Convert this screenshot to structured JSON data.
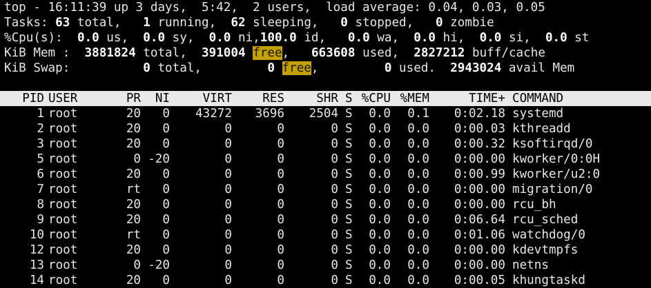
{
  "summary": {
    "top": {
      "prefix": "top - ",
      "time": "16:11:39",
      "uptime": " up 3 days,  5:42,  2 users,  load average: 0.04, 0.03, 0.05"
    },
    "tasks": {
      "label": "Tasks: ",
      "total": "63",
      "t1": " total,   ",
      "running": "1",
      "t2": " running,  ",
      "sleeping": "62",
      "t3": " sleeping,   ",
      "stopped": "0",
      "t4": " stopped,   ",
      "zombie": "0",
      "t5": " zombie"
    },
    "cpu": {
      "label": "%Cpu(s):  ",
      "us": "0.0",
      "l_us": " us,  ",
      "sy": "0.0",
      "l_sy": " sy,  ",
      "ni": "0.0",
      "l_ni": " ni,",
      "id": "100.0",
      "l_id": " id,   ",
      "wa": "0.0",
      "l_wa": " wa,  ",
      "hi": "0.0",
      "l_hi": " hi,  ",
      "si": "0.0",
      "l_si": " si,  ",
      "st": "0.0",
      "l_st": " st"
    },
    "mem": {
      "label": "KiB Mem :  ",
      "total": "3881824",
      "l_total": " total,  ",
      "free": "391004",
      "l_free_pad": " ",
      "l_free": "free",
      "l_free2": ",   ",
      "used": "663608",
      "l_used": " used,  ",
      "buff": "2827212",
      "l_buff": " buff/cache"
    },
    "swap": {
      "label": "KiB Swap:          ",
      "total": "0",
      "l_total": " total,         ",
      "free": "0",
      "l_free_pad": " ",
      "l_free": "free",
      "l_free2": ",         ",
      "used": "0",
      "l_used": " used.  ",
      "avail": "2943024",
      "l_avail": " avail Mem"
    }
  },
  "columns": {
    "pid": "PID",
    "user": "USER",
    "pr": "PR",
    "ni": "NI",
    "virt": "VIRT",
    "res": "RES",
    "shr": "SHR",
    "s": "S",
    "cpu": "%CPU",
    "mem": "%MEM",
    "time": "TIME+",
    "command": "COMMAND"
  },
  "processes": [
    {
      "pid": "1",
      "user": "root",
      "pr": "20",
      "ni": "0",
      "virt": "43272",
      "res": "3696",
      "shr": "2504",
      "s": "S",
      "cpu": "0.0",
      "mem": "0.1",
      "time": "0:02.18",
      "command": "systemd"
    },
    {
      "pid": "2",
      "user": "root",
      "pr": "20",
      "ni": "0",
      "virt": "0",
      "res": "0",
      "shr": "0",
      "s": "S",
      "cpu": "0.0",
      "mem": "0.0",
      "time": "0:00.03",
      "command": "kthreadd"
    },
    {
      "pid": "3",
      "user": "root",
      "pr": "20",
      "ni": "0",
      "virt": "0",
      "res": "0",
      "shr": "0",
      "s": "S",
      "cpu": "0.0",
      "mem": "0.0",
      "time": "0:00.32",
      "command": "ksoftirqd/0"
    },
    {
      "pid": "5",
      "user": "root",
      "pr": "0",
      "ni": "-20",
      "virt": "0",
      "res": "0",
      "shr": "0",
      "s": "S",
      "cpu": "0.0",
      "mem": "0.0",
      "time": "0:00.00",
      "command": "kworker/0:0H"
    },
    {
      "pid": "6",
      "user": "root",
      "pr": "20",
      "ni": "0",
      "virt": "0",
      "res": "0",
      "shr": "0",
      "s": "S",
      "cpu": "0.0",
      "mem": "0.0",
      "time": "0:00.99",
      "command": "kworker/u2:0"
    },
    {
      "pid": "7",
      "user": "root",
      "pr": "rt",
      "ni": "0",
      "virt": "0",
      "res": "0",
      "shr": "0",
      "s": "S",
      "cpu": "0.0",
      "mem": "0.0",
      "time": "0:00.00",
      "command": "migration/0"
    },
    {
      "pid": "8",
      "user": "root",
      "pr": "20",
      "ni": "0",
      "virt": "0",
      "res": "0",
      "shr": "0",
      "s": "S",
      "cpu": "0.0",
      "mem": "0.0",
      "time": "0:00.00",
      "command": "rcu_bh"
    },
    {
      "pid": "9",
      "user": "root",
      "pr": "20",
      "ni": "0",
      "virt": "0",
      "res": "0",
      "shr": "0",
      "s": "S",
      "cpu": "0.0",
      "mem": "0.0",
      "time": "0:06.64",
      "command": "rcu_sched"
    },
    {
      "pid": "10",
      "user": "root",
      "pr": "rt",
      "ni": "0",
      "virt": "0",
      "res": "0",
      "shr": "0",
      "s": "S",
      "cpu": "0.0",
      "mem": "0.0",
      "time": "0:01.06",
      "command": "watchdog/0"
    },
    {
      "pid": "12",
      "user": "root",
      "pr": "20",
      "ni": "0",
      "virt": "0",
      "res": "0",
      "shr": "0",
      "s": "S",
      "cpu": "0.0",
      "mem": "0.0",
      "time": "0:00.00",
      "command": "kdevtmpfs"
    },
    {
      "pid": "13",
      "user": "root",
      "pr": "0",
      "ni": "-20",
      "virt": "0",
      "res": "0",
      "shr": "0",
      "s": "S",
      "cpu": "0.0",
      "mem": "0.0",
      "time": "0:00.00",
      "command": "netns"
    },
    {
      "pid": "14",
      "user": "root",
      "pr": "20",
      "ni": "0",
      "virt": "0",
      "res": "0",
      "shr": "0",
      "s": "S",
      "cpu": "0.0",
      "mem": "0.0",
      "time": "0:00.05",
      "command": "khungtaskd"
    }
  ],
  "colors": {
    "background": "#000000",
    "foreground": "#e6e6e6",
    "highlight": "#c4a000",
    "header_bg": "#e9e9e9"
  }
}
